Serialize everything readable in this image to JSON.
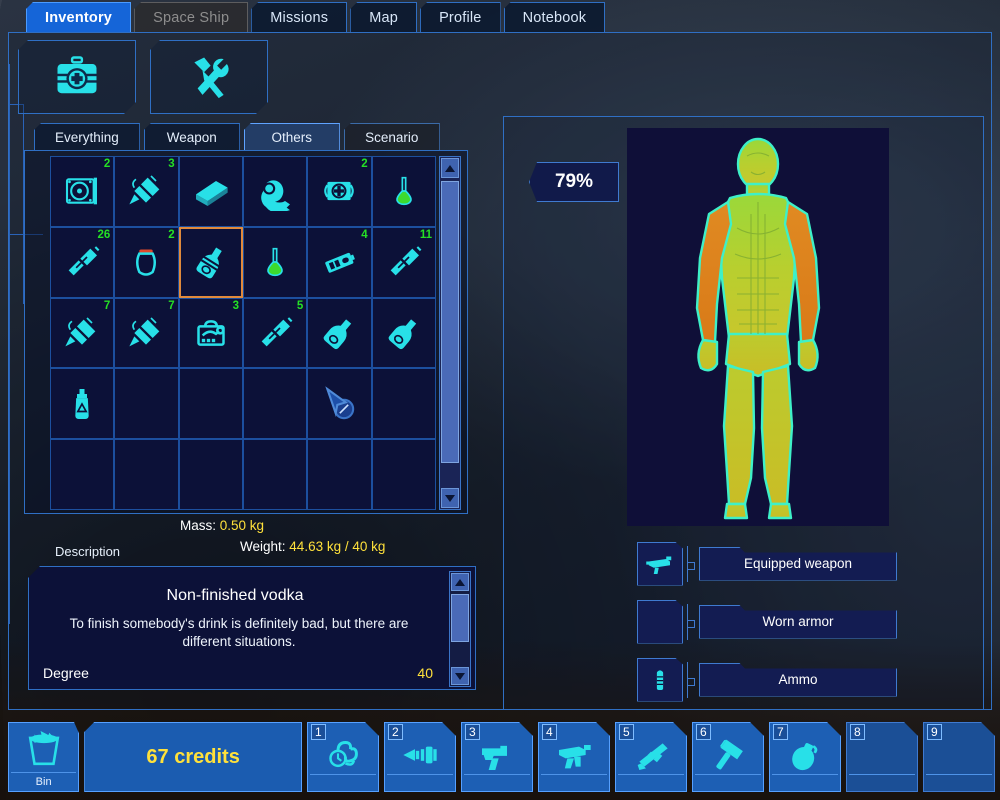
{
  "top_tabs": [
    {
      "label": "Inventory",
      "state": "active"
    },
    {
      "label": "Space Ship",
      "state": "disabled"
    },
    {
      "label": "Missions",
      "state": "normal"
    },
    {
      "label": "Map",
      "state": "normal"
    },
    {
      "label": "Profile",
      "state": "normal"
    },
    {
      "label": "Notebook",
      "state": "normal"
    }
  ],
  "action_buttons": [
    {
      "name": "medkit",
      "icon": "medkit-icon"
    },
    {
      "name": "repair",
      "icon": "hammer-wrench-icon"
    }
  ],
  "sub_tabs": [
    {
      "label": "Everything",
      "state": "normal"
    },
    {
      "label": "Weapon",
      "state": "normal"
    },
    {
      "label": "Others",
      "state": "active"
    },
    {
      "label": "Scenario",
      "state": "dim"
    }
  ],
  "grid": {
    "columns": 6,
    "rows": 5,
    "cells": [
      {
        "icon": "cd-drive-icon",
        "count": "2",
        "selected": false
      },
      {
        "icon": "syringe-icon",
        "count": "3",
        "selected": false
      },
      {
        "icon": "book-icon",
        "count": "",
        "selected": false
      },
      {
        "icon": "ham-icon",
        "count": "",
        "selected": false
      },
      {
        "icon": "firstaid-icon",
        "count": "2",
        "selected": false
      },
      {
        "icon": "flask-icon",
        "count": "",
        "selected": false
      },
      {
        "icon": "bullet-icon",
        "count": "26",
        "selected": false
      },
      {
        "icon": "jar-icon",
        "count": "2",
        "selected": false
      },
      {
        "icon": "vodka-icon",
        "count": "",
        "selected": true
      },
      {
        "icon": "flask-icon",
        "count": "",
        "selected": false
      },
      {
        "icon": "battery-icon",
        "count": "4",
        "selected": false
      },
      {
        "icon": "bullet-icon",
        "count": "11",
        "selected": false
      },
      {
        "icon": "syringe-icon",
        "count": "7",
        "selected": false
      },
      {
        "icon": "syringe-icon",
        "count": "7",
        "selected": false
      },
      {
        "icon": "toolbox-icon",
        "count": "3",
        "selected": false
      },
      {
        "icon": "bullet-icon",
        "count": "5",
        "selected": false
      },
      {
        "icon": "bottle-icon",
        "count": "",
        "selected": false
      },
      {
        "icon": "bottle-icon",
        "count": "",
        "selected": false
      },
      {
        "icon": "spraybottle-icon",
        "count": "",
        "selected": false
      },
      {
        "icon": "",
        "count": "",
        "selected": false
      },
      {
        "icon": "",
        "count": "",
        "selected": false
      },
      {
        "icon": "",
        "count": "",
        "selected": false
      },
      {
        "icon": "cursor-compass-icon",
        "count": "",
        "selected": false
      },
      {
        "icon": "",
        "count": "",
        "selected": false
      },
      {
        "icon": "",
        "count": "",
        "selected": false
      },
      {
        "icon": "",
        "count": "",
        "selected": false
      },
      {
        "icon": "",
        "count": "",
        "selected": false
      },
      {
        "icon": "",
        "count": "",
        "selected": false
      },
      {
        "icon": "",
        "count": "",
        "selected": false
      },
      {
        "icon": "",
        "count": "",
        "selected": false
      }
    ]
  },
  "stats": {
    "mass_label": "Mass:",
    "mass_value": "0.50 kg",
    "weight_label": "Weight:",
    "weight_value": "44.63 kg / 40 kg"
  },
  "description": {
    "panel_label": "Description",
    "title": "Non-finished vodka",
    "text": "To finish somebody's drink is definitely bad, but there are different situations.",
    "stat_label": "Degree",
    "stat_value": "40"
  },
  "character": {
    "health_percent": "79%",
    "body_view": "anatomical-health-figure"
  },
  "equipment": [
    {
      "label": "Equipped weapon",
      "icon": "rifle-icon",
      "filled": true
    },
    {
      "label": "Worn armor",
      "icon": "",
      "filled": false
    },
    {
      "label": "Ammo",
      "icon": "ammo-icon",
      "filled": true
    }
  ],
  "bottom": {
    "bin_label": "Bin",
    "bin_icon": "trash-bin-icon",
    "credits": "67 credits",
    "hotbar": [
      {
        "num": "1",
        "icon": "grapple-icon",
        "filled": true
      },
      {
        "num": "2",
        "icon": "drill-icon",
        "filled": true
      },
      {
        "num": "3",
        "icon": "pistol-icon",
        "filled": true
      },
      {
        "num": "4",
        "icon": "smg-icon",
        "filled": true
      },
      {
        "num": "5",
        "icon": "rifle2-icon",
        "filled": true
      },
      {
        "num": "6",
        "icon": "hammer-icon",
        "filled": true
      },
      {
        "num": "7",
        "icon": "grenade-icon",
        "filled": true
      },
      {
        "num": "8",
        "icon": "",
        "filled": false
      },
      {
        "num": "9",
        "icon": "",
        "filled": false
      }
    ]
  },
  "colors": {
    "accent_blue": "#1565d8",
    "border_blue": "#2f6fc4",
    "cell_bg": "#0c1138",
    "count_green": "#25e025",
    "value_yellow": "#ffe13b",
    "selection_orange": "#e08a3c",
    "icon_cyan": "#28e0e8"
  }
}
